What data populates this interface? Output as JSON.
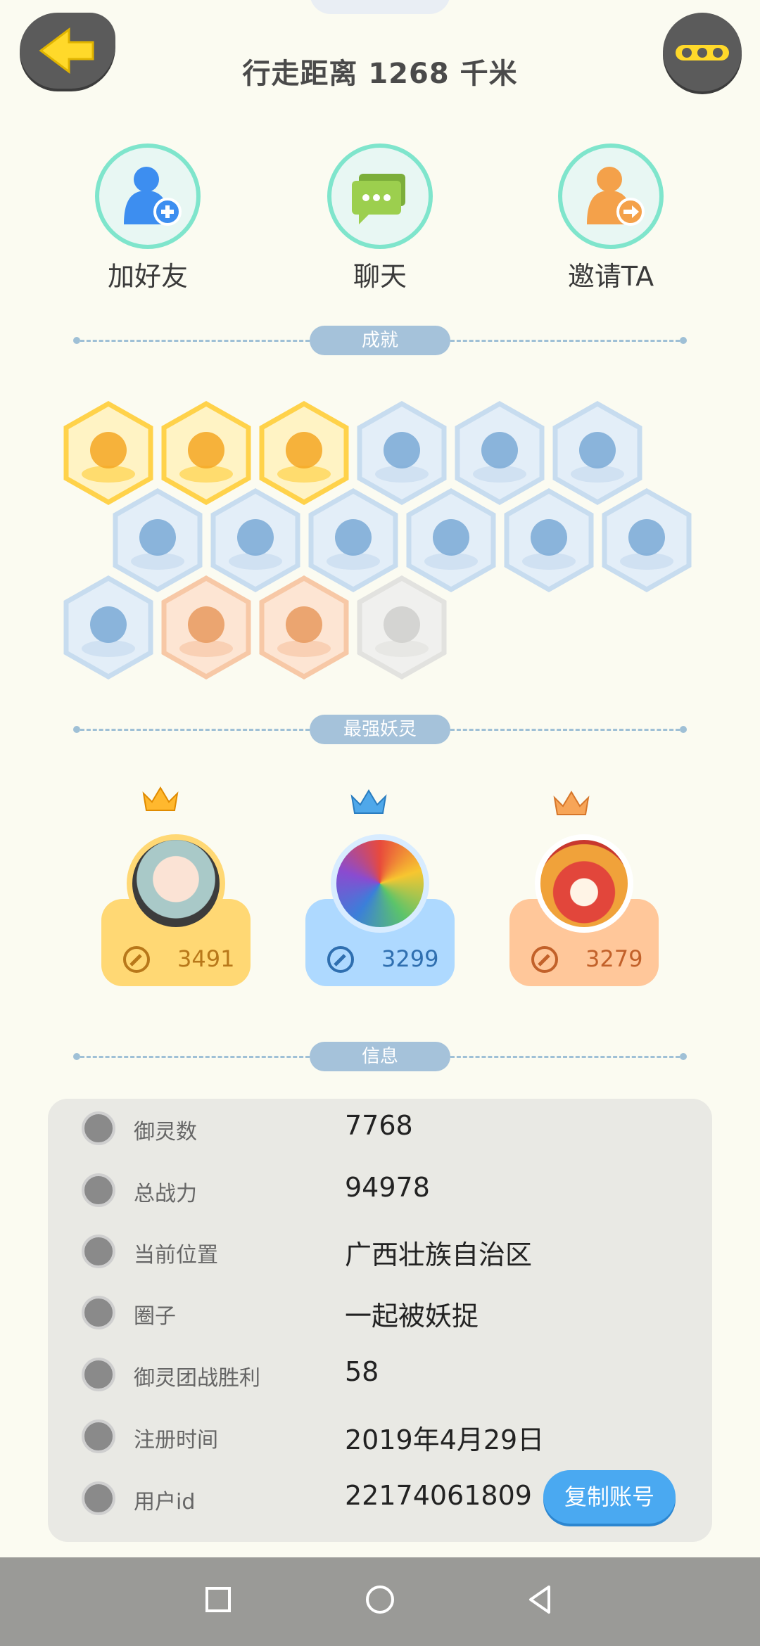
{
  "header": {
    "distance_title": "行走距离 1268 千米",
    "back_icon": "arrow-left-icon",
    "more_icon": "more-dots-icon"
  },
  "actions": [
    {
      "label": "加好友",
      "icon": "add-friend-icon"
    },
    {
      "label": "聊天",
      "icon": "chat-icon"
    },
    {
      "label": "邀请TA",
      "icon": "invite-icon"
    }
  ],
  "sections": {
    "achievements": "成就",
    "strongest": "最强妖灵",
    "info": "信息"
  },
  "achievements": {
    "badges": [
      {
        "name": "sneaker-badge",
        "tier": "gold"
      },
      {
        "name": "fox-face-badge",
        "tier": "gold"
      },
      {
        "name": "fox-kid-badge",
        "tier": "gold"
      },
      {
        "name": "orb-stand-badge",
        "tier": "blue"
      },
      {
        "name": "moon-badge",
        "tier": "blue"
      },
      {
        "name": "crystal-ball-badge",
        "tier": "blue"
      },
      {
        "name": "gem-badge",
        "tier": "blue"
      },
      {
        "name": "yin-yang-wave-badge",
        "tier": "blue"
      },
      {
        "name": "spirit-figure-badge",
        "tier": "blue"
      },
      {
        "name": "yin-yang-cube-badge",
        "tier": "blue"
      },
      {
        "name": "fish-dragon-badge",
        "tier": "blue"
      },
      {
        "name": "shrine-badge",
        "tier": "blue"
      },
      {
        "name": "creature-badge",
        "tier": "blue"
      },
      {
        "name": "cat-cart-badge",
        "tier": "orange"
      },
      {
        "name": "ox-badge",
        "tier": "orange"
      },
      {
        "name": "locked-fox-badge",
        "tier": "locked"
      }
    ]
  },
  "strongest": [
    {
      "power": "3491",
      "crown": "gold-crown-icon",
      "theme": "#ffd874",
      "text_color": "#b8781a"
    },
    {
      "power": "3299",
      "crown": "blue-crown-icon",
      "theme": "#aed9ff",
      "text_color": "#2f6fb0"
    },
    {
      "power": "3279",
      "crown": "orange-crown-icon",
      "theme": "#ffc79a",
      "text_color": "#c2612a"
    }
  ],
  "info": {
    "rows": [
      {
        "label": "御灵数",
        "value": "7768",
        "icon": "spirit-count-icon"
      },
      {
        "label": "总战力",
        "value": "94978",
        "icon": "sword-icon"
      },
      {
        "label": "当前位置",
        "value": "广西壮族自治区",
        "icon": "location-pin-icon"
      },
      {
        "label": "圈子",
        "value": "一起被妖捉",
        "icon": "circle-group-icon"
      },
      {
        "label": "御灵团战胜利",
        "value": "58",
        "icon": "team-battle-icon"
      },
      {
        "label": "注册时间",
        "value": "2019年4月29日",
        "icon": "clock-icon"
      },
      {
        "label": "用户id",
        "value": "22174061809",
        "icon": "id-card-icon"
      }
    ],
    "copy_button": "复制账号"
  },
  "nav": {
    "recent_icon": "square-icon",
    "home_icon": "circle-home-icon",
    "back_icon": "triangle-back-icon"
  }
}
